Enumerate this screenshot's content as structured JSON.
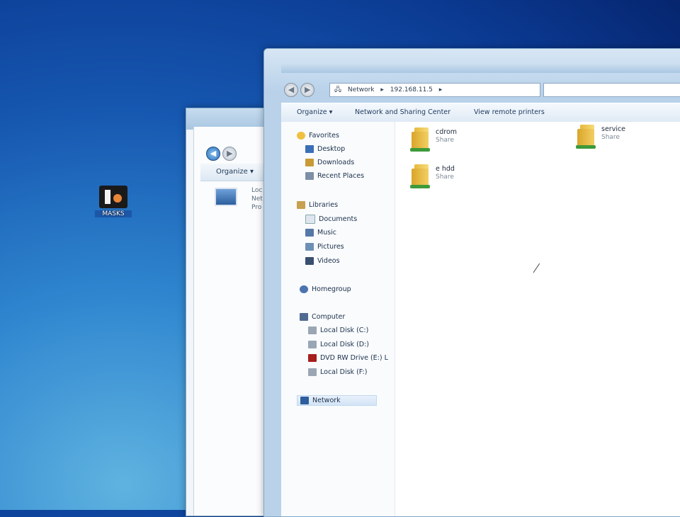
{
  "desktop": {
    "icon_label": "MASKS"
  },
  "back_window": {
    "toolbar": {
      "organize": "Organize ▾"
    },
    "content": {
      "line1": "Loc",
      "line2": "Net",
      "line3": "Pro"
    }
  },
  "front_window": {
    "address": [
      "Network",
      "▸",
      "192.168.11.5",
      "▸"
    ],
    "toolbar": {
      "organize": "Organize ▾",
      "network_center": "Network and Sharing Center",
      "remote_printers": "View remote printers"
    },
    "nav": {
      "favorites": "Favorites",
      "desktop": "Desktop",
      "downloads": "Downloads",
      "recent": "Recent Places",
      "libraries": "Libraries",
      "documents": "Documents",
      "music": "Music",
      "pictures": "Pictures",
      "videos": "Videos",
      "homegroup": "Homegroup",
      "computer": "Computer",
      "disk_c": "Local Disk (C:)",
      "disk_d": "Local Disk (D:)",
      "dvd": "DVD RW Drive (E:) L",
      "disk_f": "Local Disk (F:)",
      "network": "Network"
    },
    "files": [
      {
        "name": "cdrom",
        "sub": "Share"
      },
      {
        "name": "e hdd",
        "sub": "Share"
      },
      {
        "name": "service",
        "sub": "Share"
      }
    ]
  },
  "colors": {
    "desktop_bg": "#1657b0",
    "window_frame": "#b9d2ea",
    "folder": "#f3cf63",
    "share_pipe": "#3e9a3a"
  }
}
